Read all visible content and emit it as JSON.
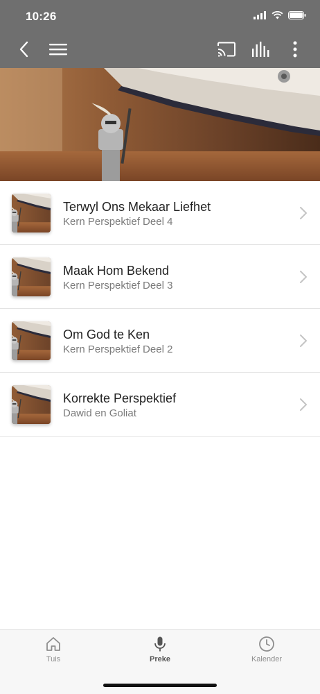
{
  "status_bar": {
    "time": "10:26"
  },
  "app_bar": {
    "icons": [
      "back-arrow-icon",
      "menu-icon",
      "cast-icon",
      "equalizer-icon",
      "more-vertical-icon"
    ]
  },
  "hero": {
    "image": "lego-knight-under-sneaker"
  },
  "sermons": [
    {
      "title": "Terwyl Ons Mekaar Liefhet",
      "series": "Kern Perspektief Deel 4"
    },
    {
      "title": "Maak Hom Bekend",
      "series": "Kern Perspektief Deel 3"
    },
    {
      "title": "Om God te Ken",
      "series": "Kern Perspektief Deel 2"
    },
    {
      "title": "Korrekte Perspektief",
      "series": "Dawid en Goliat"
    }
  ],
  "tabs": [
    {
      "label": "Tuis",
      "icon": "home-icon",
      "active": false
    },
    {
      "label": "Preke",
      "icon": "microphone-icon",
      "active": true
    },
    {
      "label": "Kalender",
      "icon": "clock-icon",
      "active": false
    }
  ],
  "colors": {
    "app_bar": "#6f6f6f",
    "active_tab": "#555555",
    "inactive_tab": "#8e8e8e"
  }
}
